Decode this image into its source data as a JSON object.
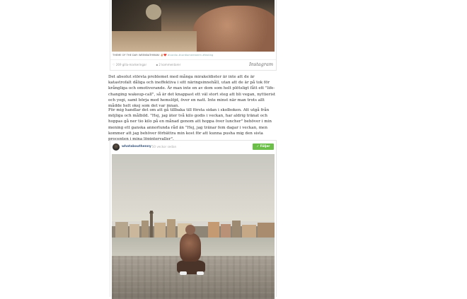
{
  "post1": {
    "caption_main": "THEME OF THE DAY: WEEKBATHMAN! ✌🏼❤️",
    "caption_tags": "#cardio #cardiomemberm #fasting",
    "likes": "269 gilla-markeringar",
    "comments": "2 kommentarer",
    "platform": "Instagram"
  },
  "article": {
    "paragraph1": "Det absolut största problemet med många mirakeldieter är inte att de är katastrofalt dåliga och ineffektiva i sitt näringsinnehåll, utan att de är på tok för krångliga och omotiverande. Är man inte en av dom som helt plötsligt fått ett \"life-changing wakeup-call\", så är det knappast ett väl stort steg att bli vegan, nyttierist och yogi, samt börja med hemslöjd, över en natt. Inte minst när man trots allt mådde helt okej som det var innan.",
    "paragraph2": "För mig handlar det om att gå tillbaka till första sidan i skolboken. Att utgå från möjliga och målbild. \"Hej, jag äter två kilo godis i veckan, har aldrig tränat och hoppas gå ner tio kilo på en månad genom att hoppa över luncher\" behöver i min mening ett ganska annorlunda råd än \"Hej, jag tränar fem dagar i veckan, men kommer att jag behöver förbättra min kost för att kunna pusha mig den sista procenten i mina löpintervaller\"."
  },
  "post2": {
    "username": "whatabouthenny",
    "time": "· 50 veckor sedan",
    "follow_label": "✓ Följer"
  }
}
